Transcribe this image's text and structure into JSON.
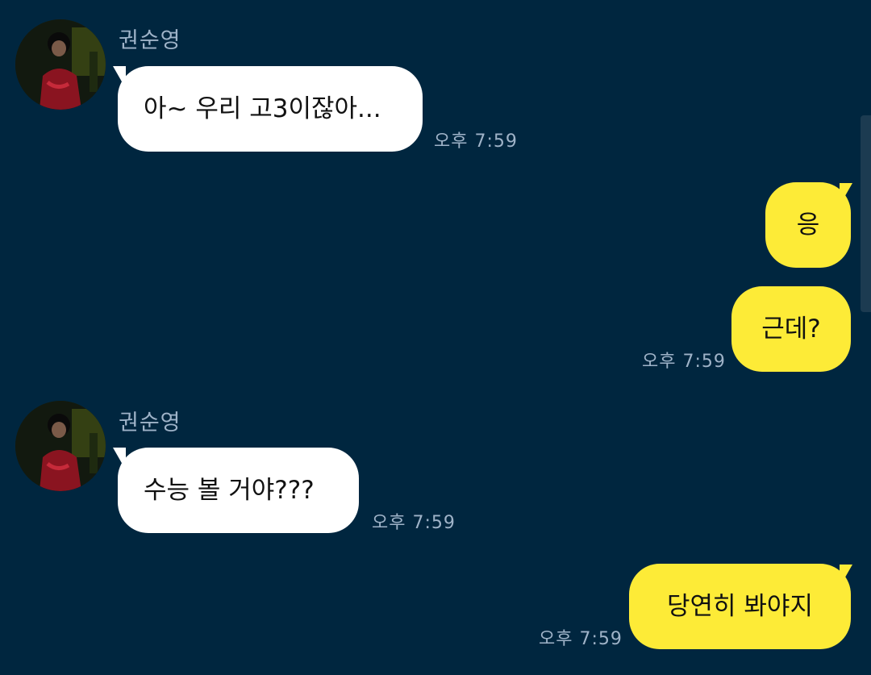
{
  "colors": {
    "background": "#00263f",
    "incoming_bubble": "#ffffff",
    "outgoing_bubble": "#fdeb37",
    "meta_text": "#9fb3c8"
  },
  "messages": [
    {
      "direction": "incoming",
      "sender": "권순영",
      "avatar_icon": "profile-photo-icon",
      "text": "아~ 우리 고3이잖아...",
      "time": "오후 7:59"
    },
    {
      "direction": "outgoing",
      "text": "응"
    },
    {
      "direction": "outgoing",
      "text": "근데?",
      "time": "오후 7:59"
    },
    {
      "direction": "incoming",
      "sender": "권순영",
      "avatar_icon": "profile-photo-icon",
      "text": "수능 볼 거야???",
      "time": "오후 7:59"
    },
    {
      "direction": "outgoing",
      "text": "당연히 봐야지",
      "time": "오후 7:59"
    }
  ]
}
